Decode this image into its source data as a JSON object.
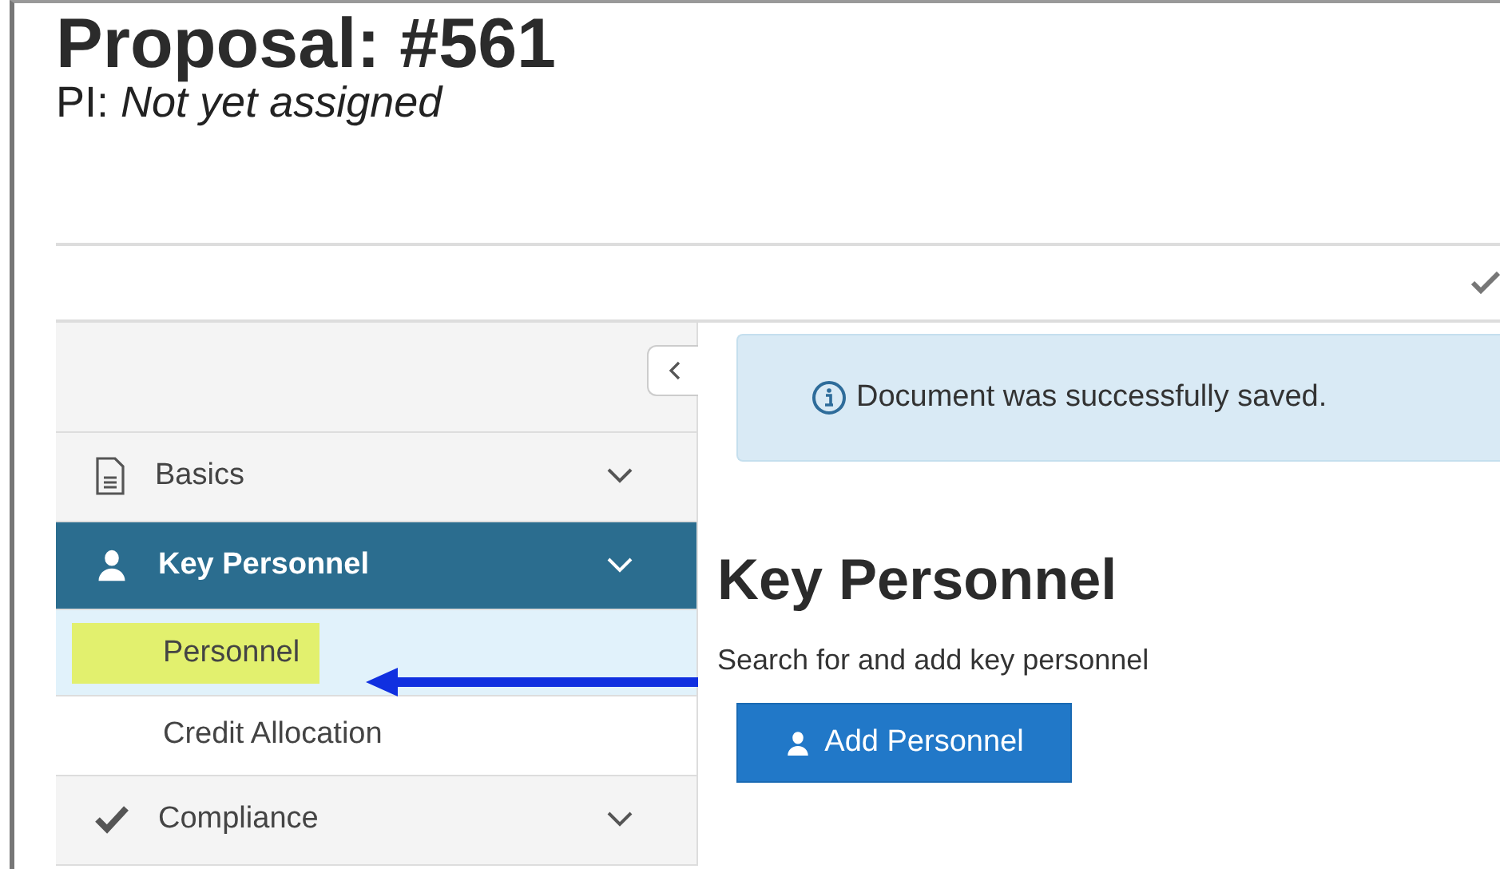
{
  "header": {
    "title": "Proposal: #561",
    "pi_label": "PI:",
    "pi_value": "Not yet assigned"
  },
  "sidebar": {
    "items": [
      {
        "label": "Basics",
        "kind": "document",
        "selected": false
      },
      {
        "label": "Key Personnel",
        "kind": "person",
        "selected": true,
        "children": [
          {
            "label": "Personnel",
            "selected": true,
            "highlighted": true
          },
          {
            "label": "Credit Allocation",
            "selected": false,
            "highlighted": false
          }
        ]
      },
      {
        "label": "Compliance",
        "kind": "check",
        "selected": false
      }
    ]
  },
  "alert": {
    "message": "Document was successfully saved."
  },
  "content": {
    "heading": "Key Personnel",
    "description": "Search for and add key personnel",
    "button": "Add Personnel"
  }
}
